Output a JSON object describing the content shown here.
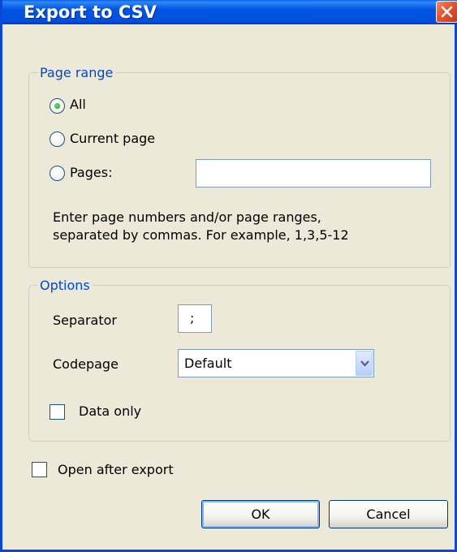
{
  "window": {
    "title": "Export to CSV",
    "close_icon": "close-icon"
  },
  "page_range": {
    "legend": "Page range",
    "options": [
      {
        "label": "All",
        "selected": true
      },
      {
        "label": "Current page",
        "selected": false
      },
      {
        "label": "Pages:",
        "selected": false
      }
    ],
    "pages_value": "",
    "hint_line1": "Enter page numbers and/or page ranges,",
    "hint_line2": "separated by commas. For example, 1,3,5-12"
  },
  "options": {
    "legend": "Options",
    "separator_label": "Separator",
    "separator_value": ";",
    "codepage_label": "Codepage",
    "codepage_value": "Default",
    "data_only_label": "Data only",
    "data_only_checked": false
  },
  "open_after_export": {
    "label": "Open after export",
    "checked": false
  },
  "buttons": {
    "ok": "OK",
    "cancel": "Cancel"
  },
  "colors": {
    "titlebar": "#0053e1",
    "group_label": "#0046d5",
    "face": "#ece9d8"
  }
}
